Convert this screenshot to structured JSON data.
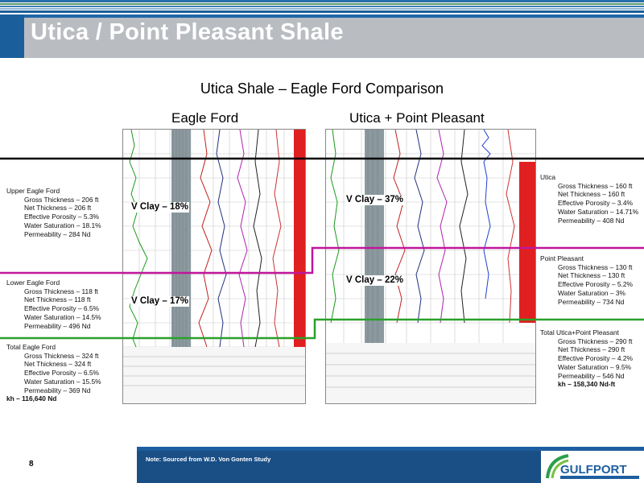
{
  "header": {
    "title": "Utica / Point Pleasant Shale"
  },
  "comparison_title": "Utica Shale – Eagle Ford Comparison",
  "columns": {
    "left": "Eagle Ford",
    "right": "Utica + Point Pleasant"
  },
  "eagle_ford": {
    "upper": {
      "heading": "Upper Eagle Ford",
      "lines": [
        "Gross Thickness – 206 ft",
        "Net Thickness – 206 ft",
        "Effective Porosity – 5.3%",
        "Water Saturation – 18.1%",
        "Permeability – 284 Nd"
      ]
    },
    "lower": {
      "heading": "Lower Eagle Ford",
      "lines": [
        "Gross Thickness – 118 ft",
        "Net Thickness – 118 ft",
        "Effective Porosity – 6.5%",
        "Water Saturation – 14.5%",
        "Permeability – 496 Nd"
      ]
    },
    "total": {
      "heading": "Total Eagle Ford",
      "lines": [
        "Gross Thickness – 324 ft",
        "Net Thickness – 324 ft",
        "Effective Porosity – 6.5%",
        "Water Saturation – 15.5%",
        "Permeability – 369 Nd"
      ],
      "kh": "kh – 116,640 Nd"
    },
    "vclay_upper": "V Clay – 18%",
    "vclay_lower": "V Clay – 17%"
  },
  "utica": {
    "utica": {
      "heading": "Utica",
      "lines": [
        "Gross Thickness – 160 ft",
        "Net Thickness – 160 ft",
        "Effective Porosity – 3.4%",
        "Water Saturation – 14.71%",
        "Permeability – 408 Nd"
      ]
    },
    "point_pleasant": {
      "heading": "Point Pleasant",
      "lines": [
        "Gross Thickness – 130 ft",
        "Net Thickness – 130 ft",
        "Effective Porosity – 5.2%",
        "Water Saturation – 3%",
        "Permeability – 734 Nd"
      ]
    },
    "total": {
      "heading": "Total Utica+Point Pleasant",
      "lines": [
        "Gross Thickness – 290 ft",
        "Net Thickness – 290 ft",
        "Effective Porosity – 4.2%",
        "Water Saturation – 9.5%",
        "Permeability – 546 Nd"
      ],
      "kh": "kh – 158,340 Nd-ft"
    },
    "vclay_upper": "V Clay – 37%",
    "vclay_lower": "V Clay – 22%"
  },
  "footer": {
    "page_number": "8",
    "note": "Note: Sourced from W.D. Von Gonten Study",
    "logo_text": "GULFPORT"
  },
  "colors": {
    "title_bar": "#2067a8",
    "footer": "#1d5ea0",
    "top_marker": "#000000",
    "middle_marker": "#c0169b",
    "bottom_marker": "#2aa02a"
  }
}
